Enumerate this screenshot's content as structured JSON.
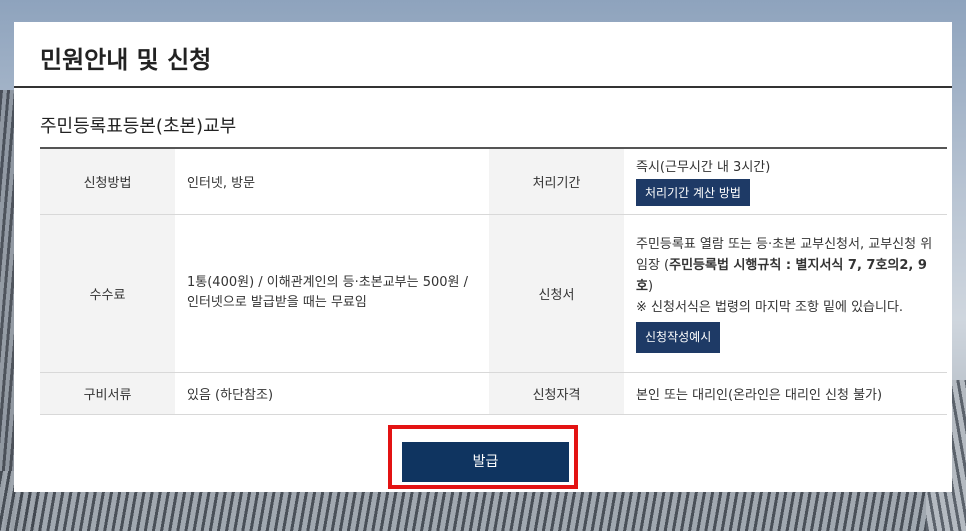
{
  "page_title": "민원안내 및 신청",
  "section_title": "주민등록표등본(초본)교부",
  "rows": {
    "method_label": "신청방법",
    "method_value": "인터넷, 방문",
    "period_label": "처리기간",
    "period_value": "즉시(근무시간 내 3시간)",
    "period_button": "처리기간 계산 방법",
    "fee_label": "수수료",
    "fee_value": "1통(400원) / 이해관계인의 등·초본교부는 500원 / 인터넷으로 발급받을 때는 무료임",
    "form_label": "신청서",
    "form_text1": "주민등록표 열람 또는 등·초본 교부신청서, 교부신청 위임장 (",
    "form_text_bold": "주민등록법 시행규칙 : 별지서식 7, 7호의2, 9호",
    "form_text2": ")",
    "form_note": "※ 신청서식은 법령의 마지막 조항 밑에 있습니다.",
    "form_button": "신청작성예시",
    "docs_label": "구비서류",
    "docs_value": "있음 (하단참조)",
    "eligibility_label": "신청자격",
    "eligibility_value": "본인 또는 대리인(온라인은 대리인 신청 불가)"
  },
  "issue_button": "발급",
  "colors": {
    "navy": "#1e3a66",
    "highlight": "#e31313"
  }
}
